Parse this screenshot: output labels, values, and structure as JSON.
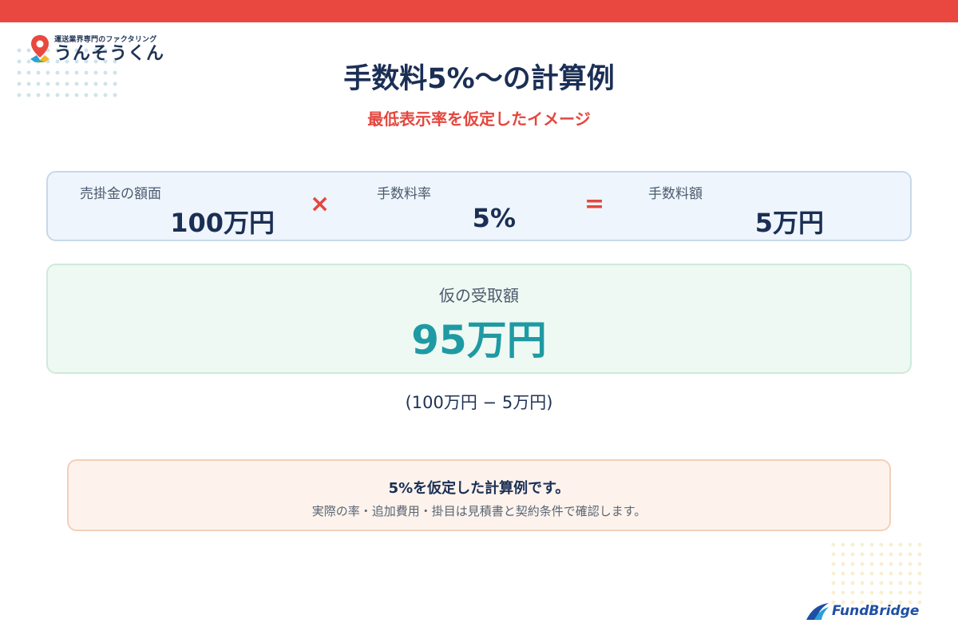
{
  "logo": {
    "tagline": "運送業界専門のファクタリング",
    "name": "うんそうくん"
  },
  "title": "手数料5%〜の計算例",
  "subtitle": "最低表示率を仮定したイメージ",
  "formula": {
    "receivable_label": "売掛金の額面",
    "receivable_value": "100万円",
    "multiply_symbol": "×",
    "rate_label": "手数料率",
    "rate_value": "5%",
    "equals_symbol": "=",
    "fee_label": "手数料額",
    "fee_value": "5万円"
  },
  "result": {
    "label": "仮の受取額",
    "value": "95万円"
  },
  "calc_note": "(100万円 − 5万円)",
  "notice": {
    "title": "5%を仮定した計算例です。",
    "body": "実際の率・追加費用・掛目は見積書と契約条件で確認します。"
  },
  "brand": {
    "name": "FundBridge"
  },
  "colors": {
    "accent_red": "#e8483f",
    "navy": "#1b2f55",
    "teal": "#1e9aa3",
    "formula_bg": "#eef5fc",
    "result_bg": "#eef9f3",
    "notice_bg": "#fdf3ec"
  }
}
